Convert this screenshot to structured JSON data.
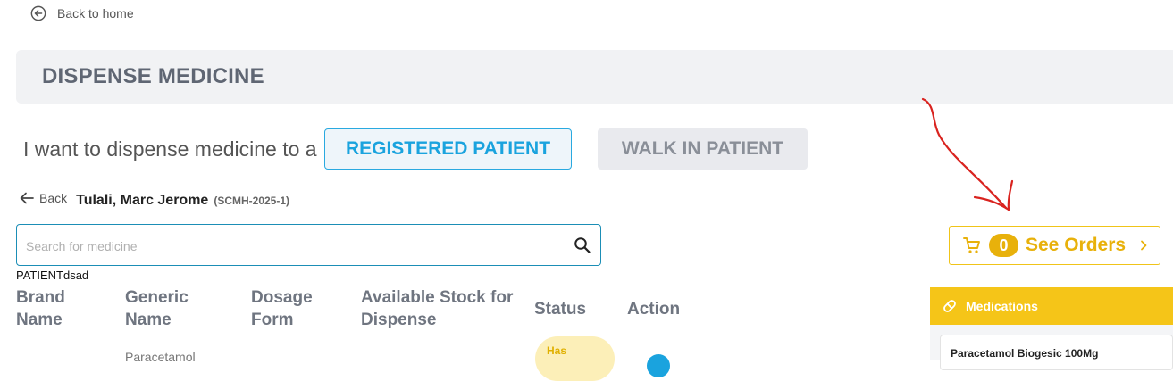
{
  "nav": {
    "back_home": "Back to home"
  },
  "header": {
    "title": "DISPENSE MEDICINE"
  },
  "dispense": {
    "prompt": "I want to dispense medicine to a",
    "registered_label": "REGISTERED PATIENT",
    "walkin_label": "WALK IN PATIENT"
  },
  "patient": {
    "back_label": "Back",
    "name": "Tulali, Marc Jerome",
    "id": "(SCMH-2025-1)",
    "tag": "PATIENTdsad"
  },
  "search": {
    "placeholder": "Search for medicine",
    "value": ""
  },
  "table": {
    "columns": [
      {
        "line1": "Brand",
        "line2": "Name"
      },
      {
        "line1": "Generic",
        "line2": "Name"
      },
      {
        "line1": "Dosage",
        "line2": "Form"
      },
      {
        "line1": "Available Stock for",
        "line2": "Dispense"
      },
      {
        "line1": "Status",
        "line2": ""
      },
      {
        "line1": "Action",
        "line2": ""
      }
    ],
    "rows": [
      {
        "generic": "Paracetamol",
        "status": "Has"
      }
    ]
  },
  "orders": {
    "count": "0",
    "label": "See Orders"
  },
  "medications": {
    "title": "Medications",
    "items": [
      "Paracetamol Biogesic 100Mg"
    ]
  },
  "colors": {
    "accent_blue": "#1aa3de",
    "accent_yellow": "#e8b10b",
    "annotation_red": "#d9231f"
  }
}
